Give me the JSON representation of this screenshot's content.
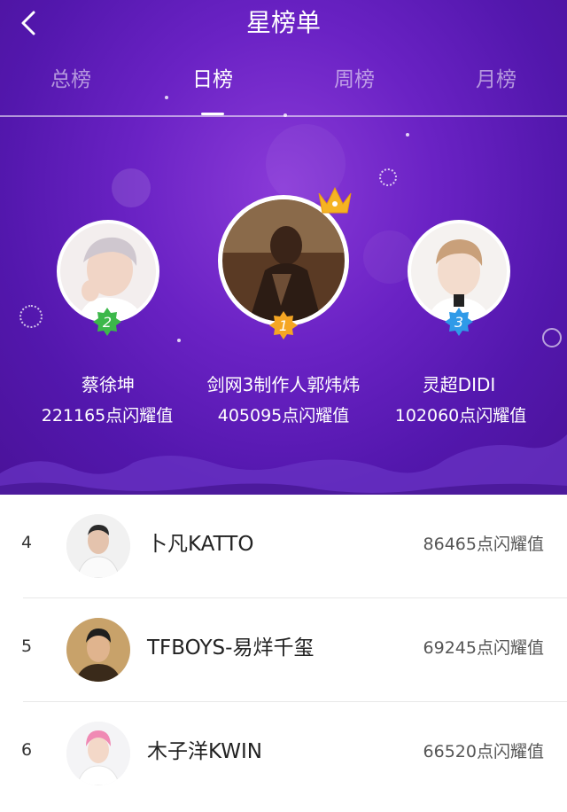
{
  "header": {
    "title": "星榜单",
    "back_icon": "chevron-left-icon"
  },
  "tabs": [
    {
      "label": "总榜",
      "active": false
    },
    {
      "label": "日榜",
      "active": true
    },
    {
      "label": "周榜",
      "active": false
    },
    {
      "label": "月榜",
      "active": false
    }
  ],
  "podium": {
    "first": {
      "rank": "1",
      "name": "剑网3制作人郭炜炜",
      "score": "405095点闪耀值",
      "crown_icon": "crown-icon"
    },
    "second": {
      "rank": "2",
      "name": "蔡徐坤",
      "score": "221165点闪耀值"
    },
    "third": {
      "rank": "3",
      "name": "灵超DIDI",
      "score": "102060点闪耀值"
    }
  },
  "list": [
    {
      "rank": "4",
      "name": "卜凡KATTO",
      "score": "86465点闪耀值"
    },
    {
      "rank": "5",
      "name": "TFBOYS-易烊千玺",
      "score": "69245点闪耀值"
    },
    {
      "rank": "6",
      "name": "木子洋KWIN",
      "score": "66520点闪耀值"
    }
  ],
  "colors": {
    "hero_purple": "#5c1ab5",
    "gold_badge": "#f5a623",
    "green_badge": "#3cb84a",
    "blue_badge": "#2f9ae8"
  }
}
